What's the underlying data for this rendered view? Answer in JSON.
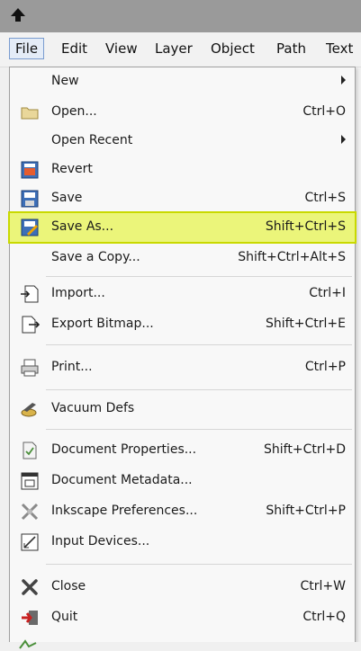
{
  "menubar": {
    "items": [
      {
        "label": "File"
      },
      {
        "label": "Edit"
      },
      {
        "label": "View"
      },
      {
        "label": "Layer"
      },
      {
        "label": "Object"
      },
      {
        "label": "Path"
      },
      {
        "label": "Text"
      }
    ]
  },
  "file_menu": {
    "items": [
      {
        "label": "New",
        "shortcut": "",
        "submenu": true
      },
      {
        "label": "Open...",
        "shortcut": "Ctrl+O"
      },
      {
        "label": "Open Recent",
        "shortcut": "",
        "submenu": true
      },
      {
        "label": "Revert",
        "shortcut": ""
      },
      {
        "label": "Save",
        "shortcut": "Ctrl+S"
      },
      {
        "label": "Save As...",
        "shortcut": "Shift+Ctrl+S",
        "highlighted": true
      },
      {
        "label": "Save a Copy...",
        "shortcut": "Shift+Ctrl+Alt+S"
      },
      {
        "label": "Import...",
        "shortcut": "Ctrl+I"
      },
      {
        "label": "Export Bitmap...",
        "shortcut": "Shift+Ctrl+E"
      },
      {
        "label": "Print...",
        "shortcut": "Ctrl+P"
      },
      {
        "label": "Vacuum Defs",
        "shortcut": ""
      },
      {
        "label": "Document Properties...",
        "shortcut": "Shift+Ctrl+D"
      },
      {
        "label": "Document Metadata...",
        "shortcut": ""
      },
      {
        "label": "Inkscape Preferences...",
        "shortcut": "Shift+Ctrl+P"
      },
      {
        "label": "Input Devices...",
        "shortcut": ""
      },
      {
        "label": "Close",
        "shortcut": "Ctrl+W"
      },
      {
        "label": "Quit",
        "shortcut": "Ctrl+Q"
      }
    ]
  },
  "colors": {
    "highlight": "#ebf57a",
    "titlebar": "#9a9a9a"
  }
}
